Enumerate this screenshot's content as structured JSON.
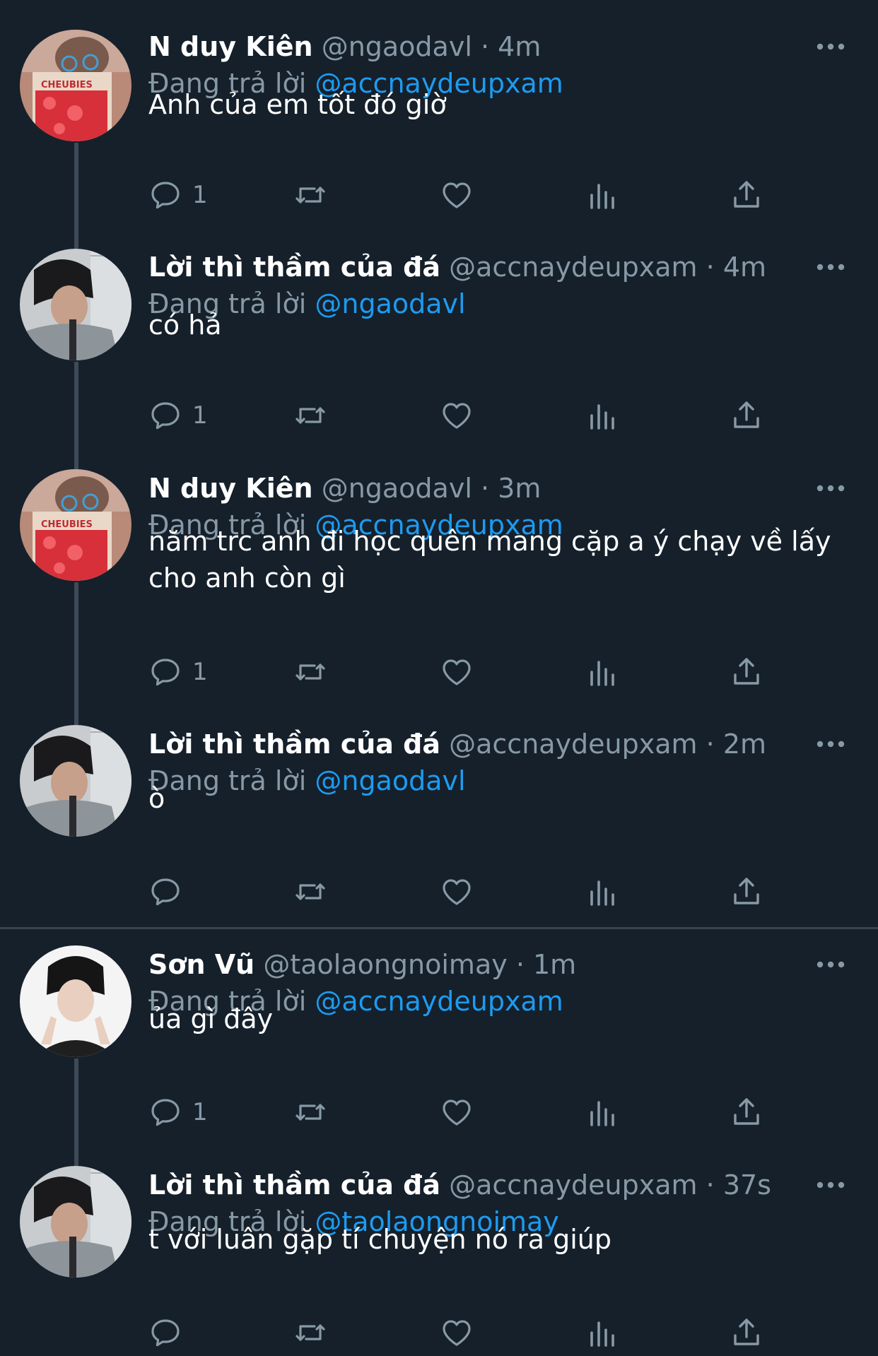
{
  "colors": {
    "background": "#15202b",
    "primary_text": "#ffffff",
    "secondary_text": "#8899a6",
    "mention": "#1d9bf0",
    "thread_line": "#3d4a57"
  },
  "tweets": [
    {
      "name": "N duy Kiên",
      "handle": "@ngaodavl",
      "time": "4m",
      "replying_prefix": "Đang trả lời",
      "replying_to": "@accnaydeupxam",
      "text": "Anh của em tốt đó giờ",
      "reply_count": "1"
    },
    {
      "name": "Lời thì thầm của đá",
      "handle": "@accnaydeupxam",
      "time": "4m",
      "replying_prefix": "Đang trả lời",
      "replying_to": "@ngaodavl",
      "text": "có hả",
      "reply_count": "1"
    },
    {
      "name": "N duy Kiên",
      "handle": "@ngaodavl",
      "time": "3m",
      "replying_prefix": "Đang trả lời",
      "replying_to": "@accnaydeupxam",
      "text": "năm trc anh đi học quên mang cặp a ý chạy về lấy cho anh còn gì",
      "reply_count": "1"
    },
    {
      "name": "Lời thì thầm của đá",
      "handle": "@accnaydeupxam",
      "time": "2m",
      "replying_prefix": "Đang trả lời",
      "replying_to": "@ngaodavl",
      "text": "ò",
      "reply_count": ""
    },
    {
      "name": "Sơn Vũ",
      "handle": "@taolaongnoimay",
      "time": "1m",
      "replying_prefix": "Đang trả lời",
      "replying_to": "@accnaydeupxam",
      "text": "ủa gì đây",
      "reply_count": "1"
    },
    {
      "name": "Lời thì thầm của đá",
      "handle": "@accnaydeupxam",
      "time": "37s",
      "replying_prefix": "Đang trả lời",
      "replying_to": "@taolaongnoimay",
      "text": "t với luân gặp tí chuyện nó ra giúp",
      "reply_count": ""
    }
  ],
  "icons": {
    "reply": "reply-icon",
    "retweet": "retweet-icon",
    "like": "heart-icon",
    "analytics": "analytics-icon",
    "share": "share-icon",
    "more": "more-icon"
  }
}
